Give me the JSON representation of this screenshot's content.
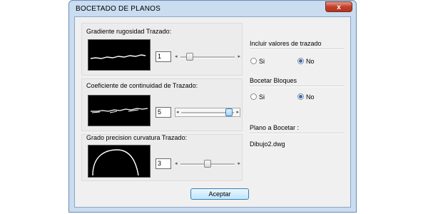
{
  "window": {
    "title": "BOCETADO DE PLANOS",
    "close_glyph": "x"
  },
  "left": {
    "group1": {
      "label": "Gradiente rugosidad Trazado:",
      "value": "1",
      "slider_position": 0.12
    },
    "group2": {
      "label": "Coeficiente de continuidad de Trazado:",
      "value": "5",
      "slider_position": 1.0
    },
    "group3": {
      "label": "Grado precision curvatura Trazado:",
      "value": "3",
      "slider_position": 0.5
    }
  },
  "right": {
    "incluir": {
      "title": "Incluir valores de trazado",
      "yes_label": "Si",
      "no_label": "No",
      "selected": "No"
    },
    "bocetar": {
      "title": "Bocetar Bloques",
      "yes_label": "Si",
      "no_label": "No",
      "selected": "No"
    },
    "plano": {
      "title": "Plano a Bocetar :",
      "file": "Dibujo2.dwg"
    }
  },
  "footer": {
    "accept_label": "Aceptar"
  },
  "colors": {
    "title_bar": "#c9dcf0",
    "dialog_bg": "#f0f0f0",
    "preview_bg": "#000000",
    "close_red": "#c2412b",
    "accent_blue": "#3c7fb1"
  }
}
